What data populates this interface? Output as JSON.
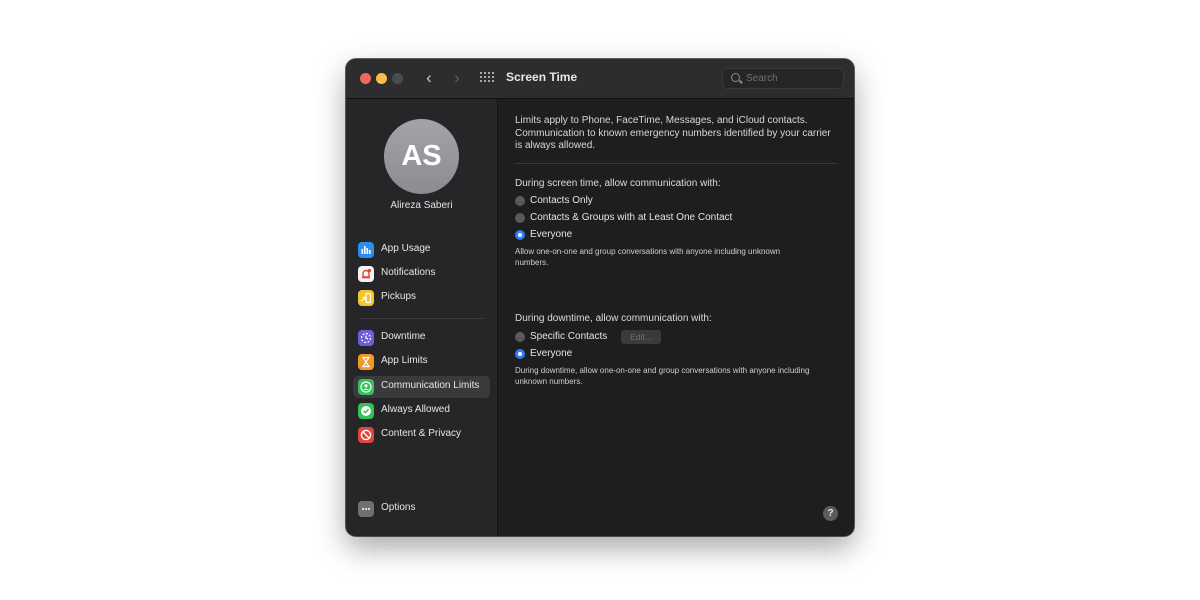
{
  "window": {
    "title": "Screen Time",
    "search_placeholder": "Search"
  },
  "sidebar": {
    "avatar_initials": "AS",
    "user_name": "Alireza Saberi",
    "groups": [
      [
        {
          "label": "App Usage",
          "icon": "bar-chart-icon",
          "color": "#2d8cf0"
        },
        {
          "label": "Notifications",
          "icon": "bell-icon",
          "color": "#f4f4f4"
        },
        {
          "label": "Pickups",
          "icon": "pickup-icon",
          "color": "#f5c629"
        }
      ],
      [
        {
          "label": "Downtime",
          "icon": "moon-clock-icon",
          "color": "#6b5fd6"
        },
        {
          "label": "App Limits",
          "icon": "hourglass-icon",
          "color": "#f19a2a"
        },
        {
          "label": "Communication Limits",
          "icon": "person-circle-icon",
          "color": "#35c05a",
          "selected": true
        },
        {
          "label": "Always Allowed",
          "icon": "checkmark-badge-icon",
          "color": "#35c05a"
        },
        {
          "label": "Content & Privacy",
          "icon": "no-entry-icon",
          "color": "#e0443a"
        }
      ]
    ],
    "options_label": "Options"
  },
  "content": {
    "intro": "Limits apply to Phone, FaceTime, Messages, and iCloud contacts. Communication to known emergency numbers identified by your carrier is always allowed.",
    "screen_time": {
      "title": "During screen time, allow communication with:",
      "options": [
        {
          "label": "Contacts Only",
          "selected": false
        },
        {
          "label": "Contacts & Groups with at Least One Contact",
          "selected": false
        },
        {
          "label": "Everyone",
          "selected": true
        }
      ],
      "help": "Allow one-on-one and group conversations with anyone including unknown numbers."
    },
    "downtime": {
      "title": "During downtime, allow communication with:",
      "options": [
        {
          "label": "Specific Contacts",
          "selected": false
        },
        {
          "label": "Everyone",
          "selected": true
        }
      ],
      "edit_label": "Edit...",
      "help": "During downtime, allow one-on-one and group conversations with anyone including unknown numbers."
    },
    "help_button": "?"
  }
}
